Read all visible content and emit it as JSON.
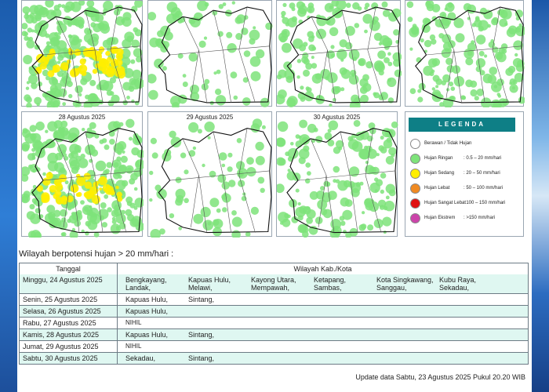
{
  "maps": [
    {
      "date": "",
      "rain": "heavy"
    },
    {
      "date": "",
      "rain": "low"
    },
    {
      "date": "",
      "rain": "medium"
    },
    {
      "date": "",
      "rain": "medium"
    },
    {
      "date": "28 Agustus 2025",
      "rain": "high"
    },
    {
      "date": "29 Agustus 2025",
      "rain": "low"
    },
    {
      "date": "30 Agustus 2025",
      "rain": "medium"
    }
  ],
  "legend": {
    "title": "LEGENDA",
    "items": [
      {
        "label": "Berawan / Tidak Hujan",
        "range": "",
        "color": "#ffffff"
      },
      {
        "label": "Hujan Ringan",
        "range": ": 0.5 – 20 mm/hari",
        "color": "#7ee37a"
      },
      {
        "label": "Hujan Sedang",
        "range": ": 20 – 50 mm/hari",
        "color": "#ffee00"
      },
      {
        "label": "Hujan Lebat",
        "range": ": 50 – 100 mm/hari",
        "color": "#f08a22"
      },
      {
        "label": "Hujan Sangat Lebat",
        "range": ": 100 – 150 mm/hari",
        "color": "#e01010"
      },
      {
        "label": "Hujan Ekstrem",
        "range": ": >150 mm/hari",
        "color": "#cc44aa"
      }
    ]
  },
  "section_title": "Wilayah berpotensi hujan > 20 mm/hari :",
  "table": {
    "header_date": "Tanggal",
    "header_region": "Wilayah Kab./Kota",
    "rows": [
      {
        "date": "Minggu, 24 Agustus 2025",
        "lines": [
          [
            "Bengkayang,",
            "Kapuas Hulu,",
            "Kayong Utara,",
            "Ketapang,",
            "Kota Singkawang,",
            "Kubu Raya,"
          ],
          [
            "Landak,",
            "Melawi,",
            "Mempawah,",
            "Sambas,",
            "Sanggau,",
            "Sekadau,"
          ]
        ]
      },
      {
        "date": "Senin, 25 Agustus 2025",
        "lines": [
          [
            "Kapuas Hulu,",
            "Sintang,"
          ]
        ]
      },
      {
        "date": "Selasa, 26 Agustus 2025",
        "lines": [
          [
            "Kapuas Hulu,"
          ]
        ]
      },
      {
        "date": "Rabu, 27 Agustus 2025",
        "lines": [
          [
            "NIHIL"
          ]
        ]
      },
      {
        "date": "Kamis, 28 Agustus 2025",
        "lines": [
          [
            "Kapuas Hulu,",
            "Sintang,"
          ]
        ]
      },
      {
        "date": "Jumat, 29 Agustus 2025",
        "lines": [
          [
            "NIHIL"
          ]
        ]
      },
      {
        "date": "Sabtu, 30 Agustus 2025",
        "lines": [
          [
            "Sekadau,",
            "Sintang,"
          ]
        ]
      }
    ]
  },
  "update_note": "Update data Sabtu, 23 Agustus 2025 Pukul 20.20 WIB"
}
